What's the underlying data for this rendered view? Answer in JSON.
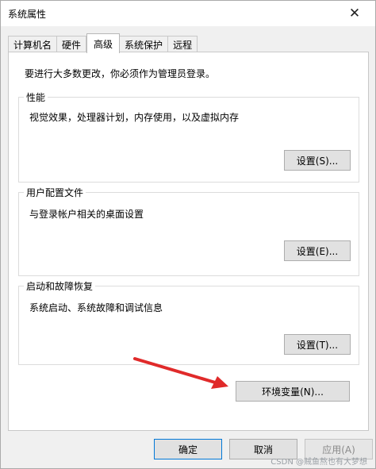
{
  "window": {
    "title": "系统属性"
  },
  "tabs": [
    {
      "label": "计算机名"
    },
    {
      "label": "硬件"
    },
    {
      "label": "高级"
    },
    {
      "label": "系统保护"
    },
    {
      "label": "远程"
    }
  ],
  "active_tab": "高级",
  "intro_text": "要进行大多数更改，你必须作为管理员登录。",
  "groups": {
    "performance": {
      "title": "性能",
      "description": "视觉效果，处理器计划，内存使用，以及虚拟内存",
      "button": "设置(S)..."
    },
    "user_profiles": {
      "title": "用户配置文件",
      "description": "与登录帐户相关的桌面设置",
      "button": "设置(E)..."
    },
    "startup_recovery": {
      "title": "启动和故障恢复",
      "description": "系统启动、系统故障和调试信息",
      "button": "设置(T)..."
    }
  },
  "env_button": "环境变量(N)...",
  "footer": {
    "ok": "确定",
    "cancel": "取消",
    "apply": "应用(A)"
  },
  "watermark": "CSDN @贼鱼熬也有大梦想",
  "colors": {
    "arrow": "#e02a2a",
    "button_face": "#e1e1e1",
    "button_border": "#adadad",
    "panel": "#ffffff",
    "window": "#f0f0f0"
  }
}
